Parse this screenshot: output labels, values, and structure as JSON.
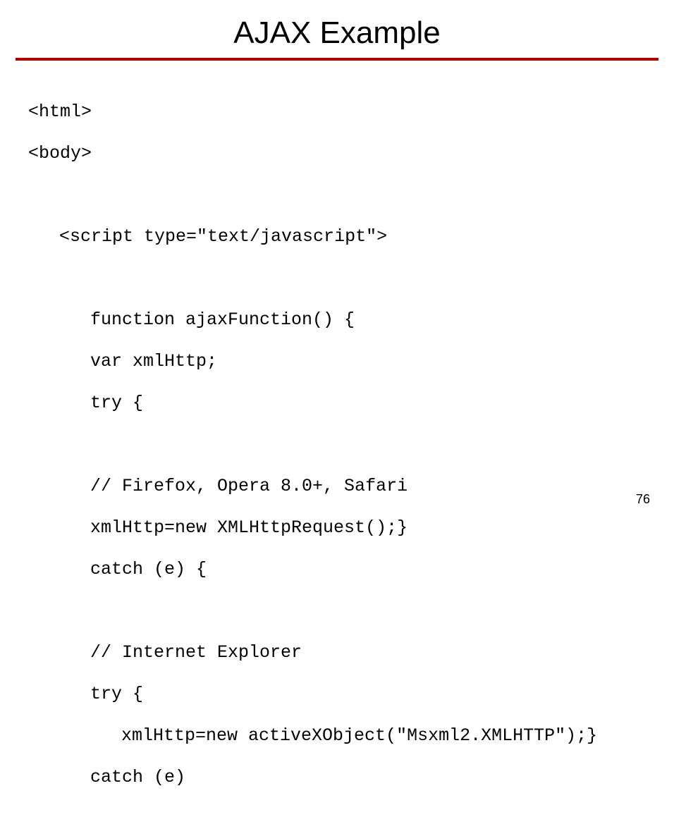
{
  "title": "AJAX Example",
  "page_number": "76",
  "code": {
    "l0": "<html>",
    "l1": "<body>",
    "l2": "<script type=\"text/javascript\">",
    "l3": "function ajaxFunction() {",
    "l4": "var xmlHttp;",
    "l5": "try {",
    "l6": "// Firefox, Opera 8.0+, Safari",
    "l7": "xmlHttp=new XMLHttpRequest();}",
    "l8": "catch (e) {",
    "l9": "// Internet Explorer",
    "l10": "try {",
    "l11": "xmlHttp=new activeXObject(\"Msxml2.XMLHTTP\");}",
    "l12": "catch (e)"
  }
}
